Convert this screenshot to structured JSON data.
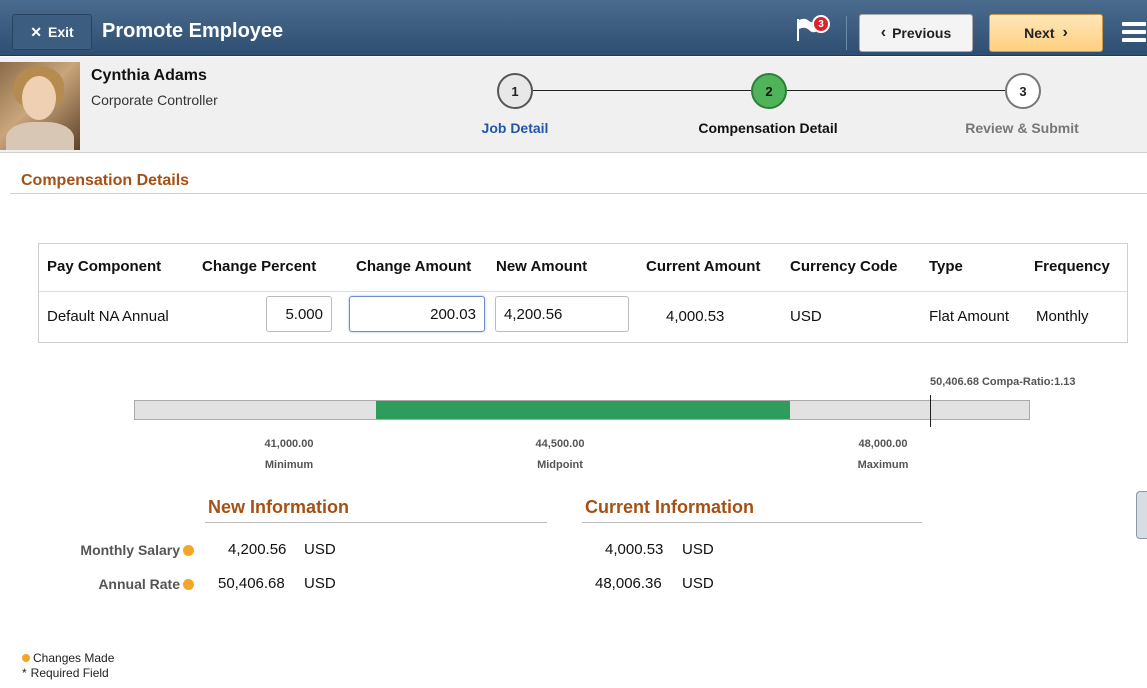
{
  "header": {
    "exit_label": "Exit",
    "title": "Promote Employee",
    "flag_count": "3",
    "previous_label": "Previous",
    "next_label": "Next"
  },
  "employee": {
    "name": "Cynthia Adams",
    "title": "Corporate Controller"
  },
  "steps": [
    {
      "number": "1",
      "label": "Job Detail",
      "state": "done"
    },
    {
      "number": "2",
      "label": "Compensation Detail",
      "state": "active"
    },
    {
      "number": "3",
      "label": "Review & Submit",
      "state": "future"
    }
  ],
  "section": {
    "title": "Compensation Details"
  },
  "table": {
    "headers": [
      "Pay Component",
      "Change Percent",
      "Change Amount",
      "New Amount",
      "Current Amount",
      "Currency Code",
      "Type",
      "Frequency"
    ],
    "row": {
      "pay_component": "Default NA Annual",
      "change_percent": "5.000",
      "change_amount": "200.03",
      "new_amount": "4,200.56",
      "current_amount": "4,000.53",
      "currency_code": "USD",
      "type": "Flat Amount",
      "frequency": "Monthly"
    }
  },
  "range": {
    "compa_label": "50,406.68 Compa-Ratio:1.13",
    "minimum_value": "41,000.00",
    "minimum_label": "Minimum",
    "midpoint_value": "44,500.00",
    "midpoint_label": "Midpoint",
    "maximum_value": "48,000.00",
    "maximum_label": "Maximum"
  },
  "info": {
    "new_heading": "New Information",
    "current_heading": "Current Information",
    "rows": [
      {
        "label": "Monthly Salary",
        "new_amount": "4,200.56",
        "new_currency": "USD",
        "current_amount": "4,000.53",
        "current_currency": "USD"
      },
      {
        "label": "Annual Rate",
        "new_amount": "50,406.68",
        "new_currency": "USD",
        "current_amount": "48,006.36",
        "current_currency": "USD"
      }
    ]
  },
  "legend": {
    "changes_made": "Changes Made",
    "required_marker": "*",
    "required_field": "Required Field"
  },
  "colors": {
    "header_bg": "#3b5b7e",
    "accent_orange": "#a55116",
    "active_step": "#4fb35a",
    "range_fill": "#2e9c5b",
    "changed_dot": "#f5a623",
    "flag_badge": "#d9232e",
    "next_button": "#ffd48f"
  },
  "icons": {
    "exit": "close-x-icon",
    "flag": "notification-flag-icon",
    "previous": "chevron-left-icon",
    "next": "chevron-right-icon",
    "menu": "hamburger-menu-icon",
    "changed": "orange-dot-icon"
  }
}
